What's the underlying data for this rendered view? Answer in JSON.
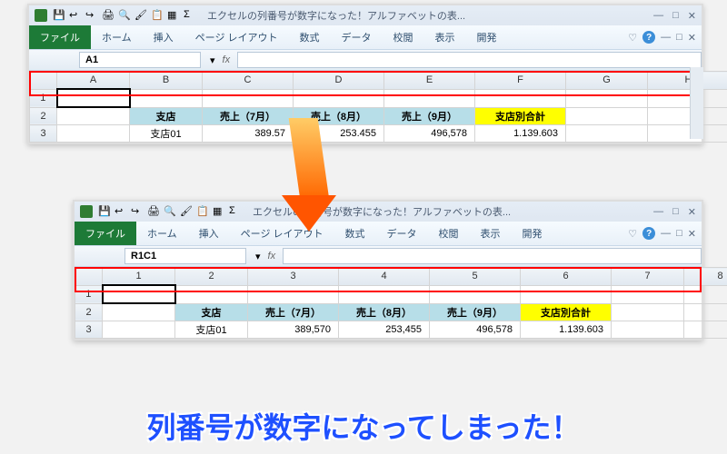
{
  "title": "エクセルの列番号が数字になった！アルファベットの表...",
  "ribbon": {
    "file": "ファイル",
    "tabs": [
      "ホーム",
      "挿入",
      "ページ レイアウト",
      "数式",
      "データ",
      "校閲",
      "表示",
      "開発"
    ]
  },
  "namebox": {
    "a1": "A1",
    "r1c1": "R1C1"
  },
  "fx": "fx",
  "cols_alpha": [
    "A",
    "B",
    "C",
    "D",
    "E",
    "F",
    "G",
    "H"
  ],
  "cols_num": [
    "1",
    "2",
    "3",
    "4",
    "5",
    "6",
    "7",
    "8"
  ],
  "rows": [
    "1",
    "2",
    "3"
  ],
  "headers": {
    "branch": "支店",
    "jul": "売上（7月）",
    "aug": "売上（8月）",
    "sep": "売上（9月）",
    "total": "支店別合計"
  },
  "data": {
    "branch": "支店01",
    "jul": "389,570",
    "jul_cut": "389.57",
    "aug": "253,455",
    "aug_cut": "253.455",
    "sep": "496,578",
    "sep_cut": "496,578",
    "total": "1,139,603",
    "total_cut": "1.139.603"
  },
  "caption": "列番号が数字になってしまった！",
  "winctl": {
    "heart": "♡",
    "up": "△",
    "min": "—",
    "max": "□",
    "close": "✕"
  }
}
